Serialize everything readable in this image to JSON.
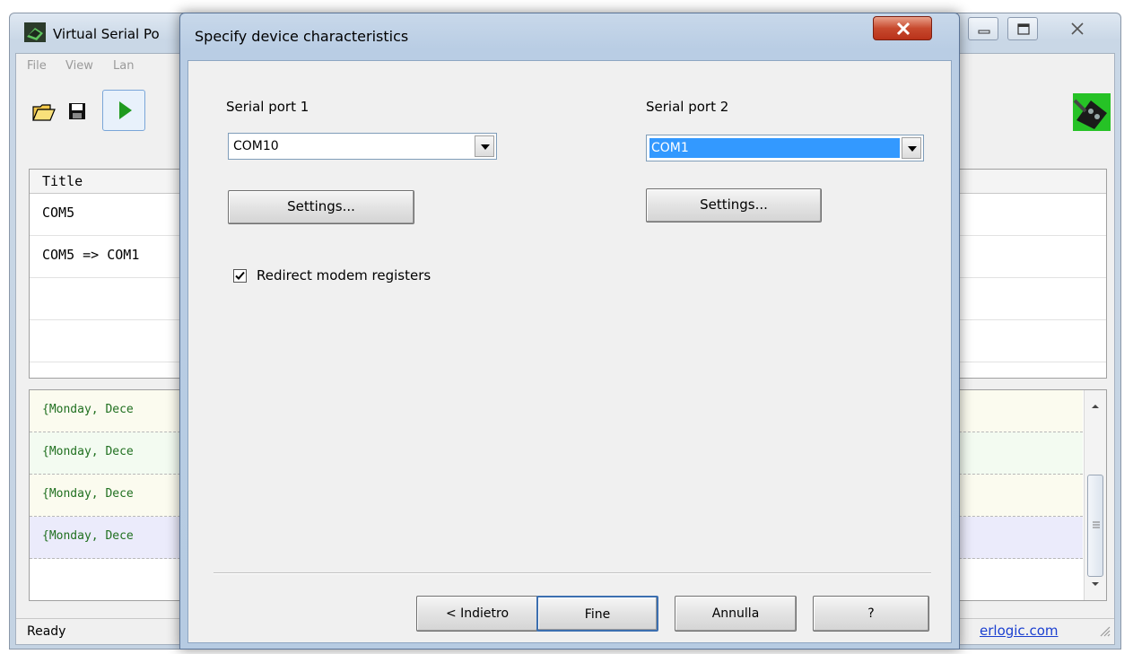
{
  "main_window": {
    "title": "Virtual Serial Po",
    "menu": [
      "File",
      "View",
      "Lan"
    ],
    "device_list": {
      "header": "Title",
      "rows": [
        "COM5",
        "COM5 => COM1"
      ]
    },
    "log_rows": [
      "{Monday, Dece",
      "{Monday, Dece",
      "{Monday, Dece",
      "{Monday, Dece"
    ],
    "log_row_colors": [
      "#fbfbef",
      "#f3fbf1",
      "#fbfbef",
      "#ebebfb"
    ],
    "status": "Ready",
    "status_link": "erlogic.com"
  },
  "dialog": {
    "title": "Specify device characteristics",
    "port1": {
      "label": "Serial port 1",
      "value": "COM10",
      "settings_label": "Settings..."
    },
    "port2": {
      "label": "Serial port 2",
      "value": "COM1",
      "settings_label": "Settings..."
    },
    "redirect_label": "Redirect modem registers",
    "redirect_checked": true,
    "buttons": {
      "back": "< Indietro",
      "finish": "Fine",
      "cancel": "Annulla",
      "help": "?"
    }
  }
}
